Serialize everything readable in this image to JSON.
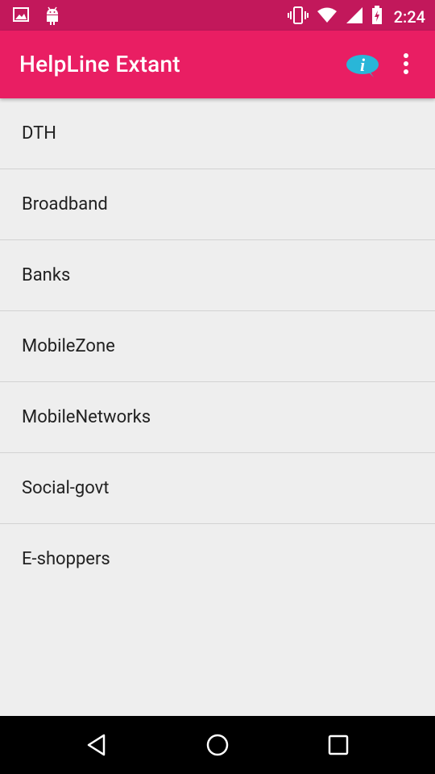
{
  "status_bar": {
    "time": "2:24",
    "icons": [
      "image-icon",
      "android-icon",
      "vibrate-icon",
      "wifi-icon",
      "signal-icon",
      "battery-charging-icon"
    ]
  },
  "app_bar": {
    "title": "HelpLine Extant",
    "actions": [
      "info-icon",
      "overflow-menu-icon"
    ]
  },
  "categories": [
    {
      "label": "DTH"
    },
    {
      "label": "Broadband"
    },
    {
      "label": "Banks"
    },
    {
      "label": "MobileZone"
    },
    {
      "label": "MobileNetworks"
    },
    {
      "label": "Social-govt"
    },
    {
      "label": "E-shoppers"
    }
  ],
  "nav_bar": {
    "buttons": [
      "back-icon",
      "home-icon",
      "recents-icon"
    ]
  },
  "colors": {
    "status_bar": "#c2185b",
    "app_bar": "#e91e63",
    "background": "#eeeeee",
    "info_icon": "#29b6d8"
  }
}
